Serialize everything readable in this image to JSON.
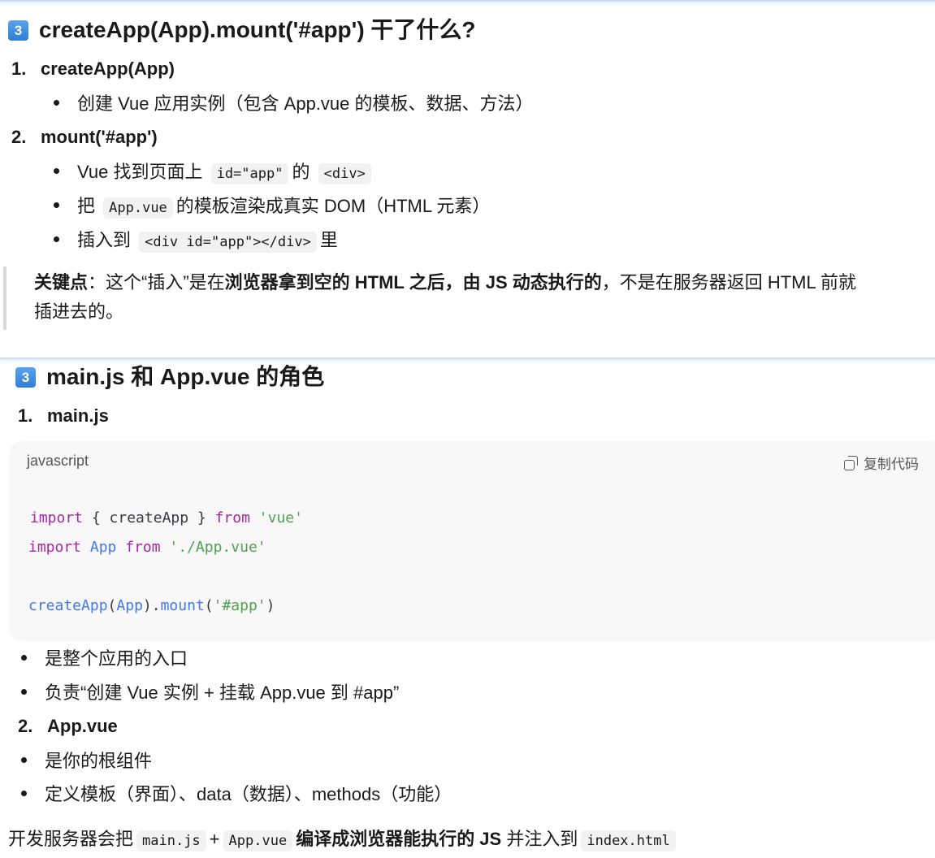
{
  "section1": {
    "badge": "3",
    "heading": "createApp(App).mount('#app') 干了什么?",
    "item1": {
      "num": "1.",
      "title": "createApp(App)",
      "bullet": "创建 Vue 应用实例（包含 App.vue 的模板、数据、方法）"
    },
    "item2": {
      "num": "2.",
      "title": "mount('#app')",
      "b1_pre": "Vue 找到页面上",
      "b1_code1": "id=\"app\"",
      "b1_mid": "的",
      "b1_code2": "<div>",
      "b2_pre": "把",
      "b2_code": "App.vue",
      "b2_post": "的模板渲染成真实 DOM（HTML 元素）",
      "b3_pre": "插入到",
      "b3_code": "<div id=\"app\"></div>",
      "b3_post": "里"
    },
    "quote": {
      "bold1": "关键点",
      "text1": "：这个“插入”是在",
      "bold2": "浏览器拿到空的 HTML 之后，由 JS 动态执行的",
      "text2": "，不是在服务器返回 HTML 前就",
      "line2": "插进去的。"
    }
  },
  "section2": {
    "badge": "3",
    "heading": "main.js 和 App.vue 的角色",
    "item1": {
      "num": "1.",
      "title": "main.js"
    },
    "code": {
      "language": "javascript",
      "copy_label": "复制代码",
      "l1_kw1": "import",
      "l1_a": " { createApp } ",
      "l1_kw2": "from",
      "l1_str": " 'vue'",
      "l2_kw1": "import",
      "l2_id": " App",
      "l2_kw2": " from",
      "l2_str": " './App.vue'",
      "l3_fn": "createApp",
      "l3_p1": "(",
      "l3_id": "App",
      "l3_p2": ").",
      "l3_fn2": "mount",
      "l3_p3": "(",
      "l3_str": "'#app'",
      "l3_p4": ")"
    },
    "bullets1": [
      "是整个应用的入口",
      "负责“创建 Vue 实例 + 挂载 App.vue 到 #app”"
    ],
    "item2": {
      "num": "2.",
      "title": "App.vue"
    },
    "bullets2": [
      "是你的根组件",
      "定义模板（界面）、data（数据）、methods（功能）"
    ],
    "footer": {
      "pre": "开发服务器会把",
      "code1": "main.js",
      "plus": "+",
      "code2": "App.vue",
      "bold": "编译成浏览器能执行的 JS",
      "mid": "并注入到",
      "code3": "index.html"
    }
  }
}
